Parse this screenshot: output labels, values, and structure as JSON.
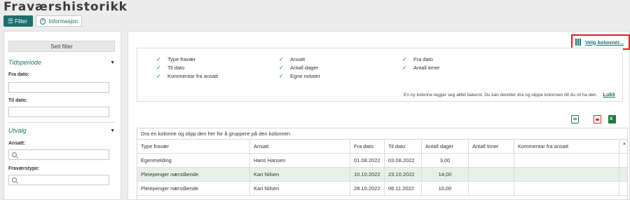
{
  "page": {
    "title": "Fraværshistorikk"
  },
  "toolbar": {
    "filter_label": "Filter",
    "info_label": "Informasjon"
  },
  "sidebar": {
    "set_filter_label": "Sett filter",
    "period_section": "Tidsperiode",
    "from_date_label": "Fra dato:",
    "from_date_value": "",
    "to_date_label": "Til dato:",
    "to_date_value": "",
    "selection_section": "Utvalg",
    "employee_label": "Ansatt:",
    "employee_value": "",
    "absence_type_label": "Fraværstype:",
    "absence_type_value": ""
  },
  "columns_chooser": {
    "link_label": "Velg kolonner...",
    "options": [
      {
        "label": "Type fravær",
        "checked": true
      },
      {
        "label": "Til dato",
        "checked": true
      },
      {
        "label": "Kommentar fra ansatt",
        "checked": true
      },
      {
        "label": "Ansatt",
        "checked": true
      },
      {
        "label": "Antall dager",
        "checked": true
      },
      {
        "label": "Egne notater",
        "checked": true
      },
      {
        "label": "Fra dato",
        "checked": true
      },
      {
        "label": "Antall timer",
        "checked": true
      }
    ],
    "info_text": "En ny kolonne legger seg alltid bakerst. Du kan deretter dra og slippe kolonnen dit du vil ha den.",
    "close_label": "Lukk"
  },
  "grid": {
    "group_hint": "Dra en kolonne og slipp den her for å gruppere på den kolonnen",
    "headers": [
      "Type fravær",
      "Ansatt",
      "Fra dato",
      "Til dato",
      "Antall dager",
      "Antall timer",
      "Kommentar fra ansatt"
    ],
    "rows": [
      [
        "Egenmelding",
        "Hans Hansen",
        "01.08.2022",
        "03.08.2022",
        "3,00",
        "",
        ""
      ],
      [
        "Pleiepenger nærstående",
        "Kari Nilsen",
        "10.10.2022",
        "23.10.2022",
        "14,00",
        "",
        ""
      ],
      [
        "Pleiepenger nærstående",
        "Kari Nilsen",
        "28.10.2022",
        "06.11.2022",
        "10,00",
        "",
        ""
      ]
    ]
  },
  "colors": {
    "accent": "#1d6f6c",
    "highlight_border": "#e02020",
    "alt_row": "#e8efea"
  }
}
